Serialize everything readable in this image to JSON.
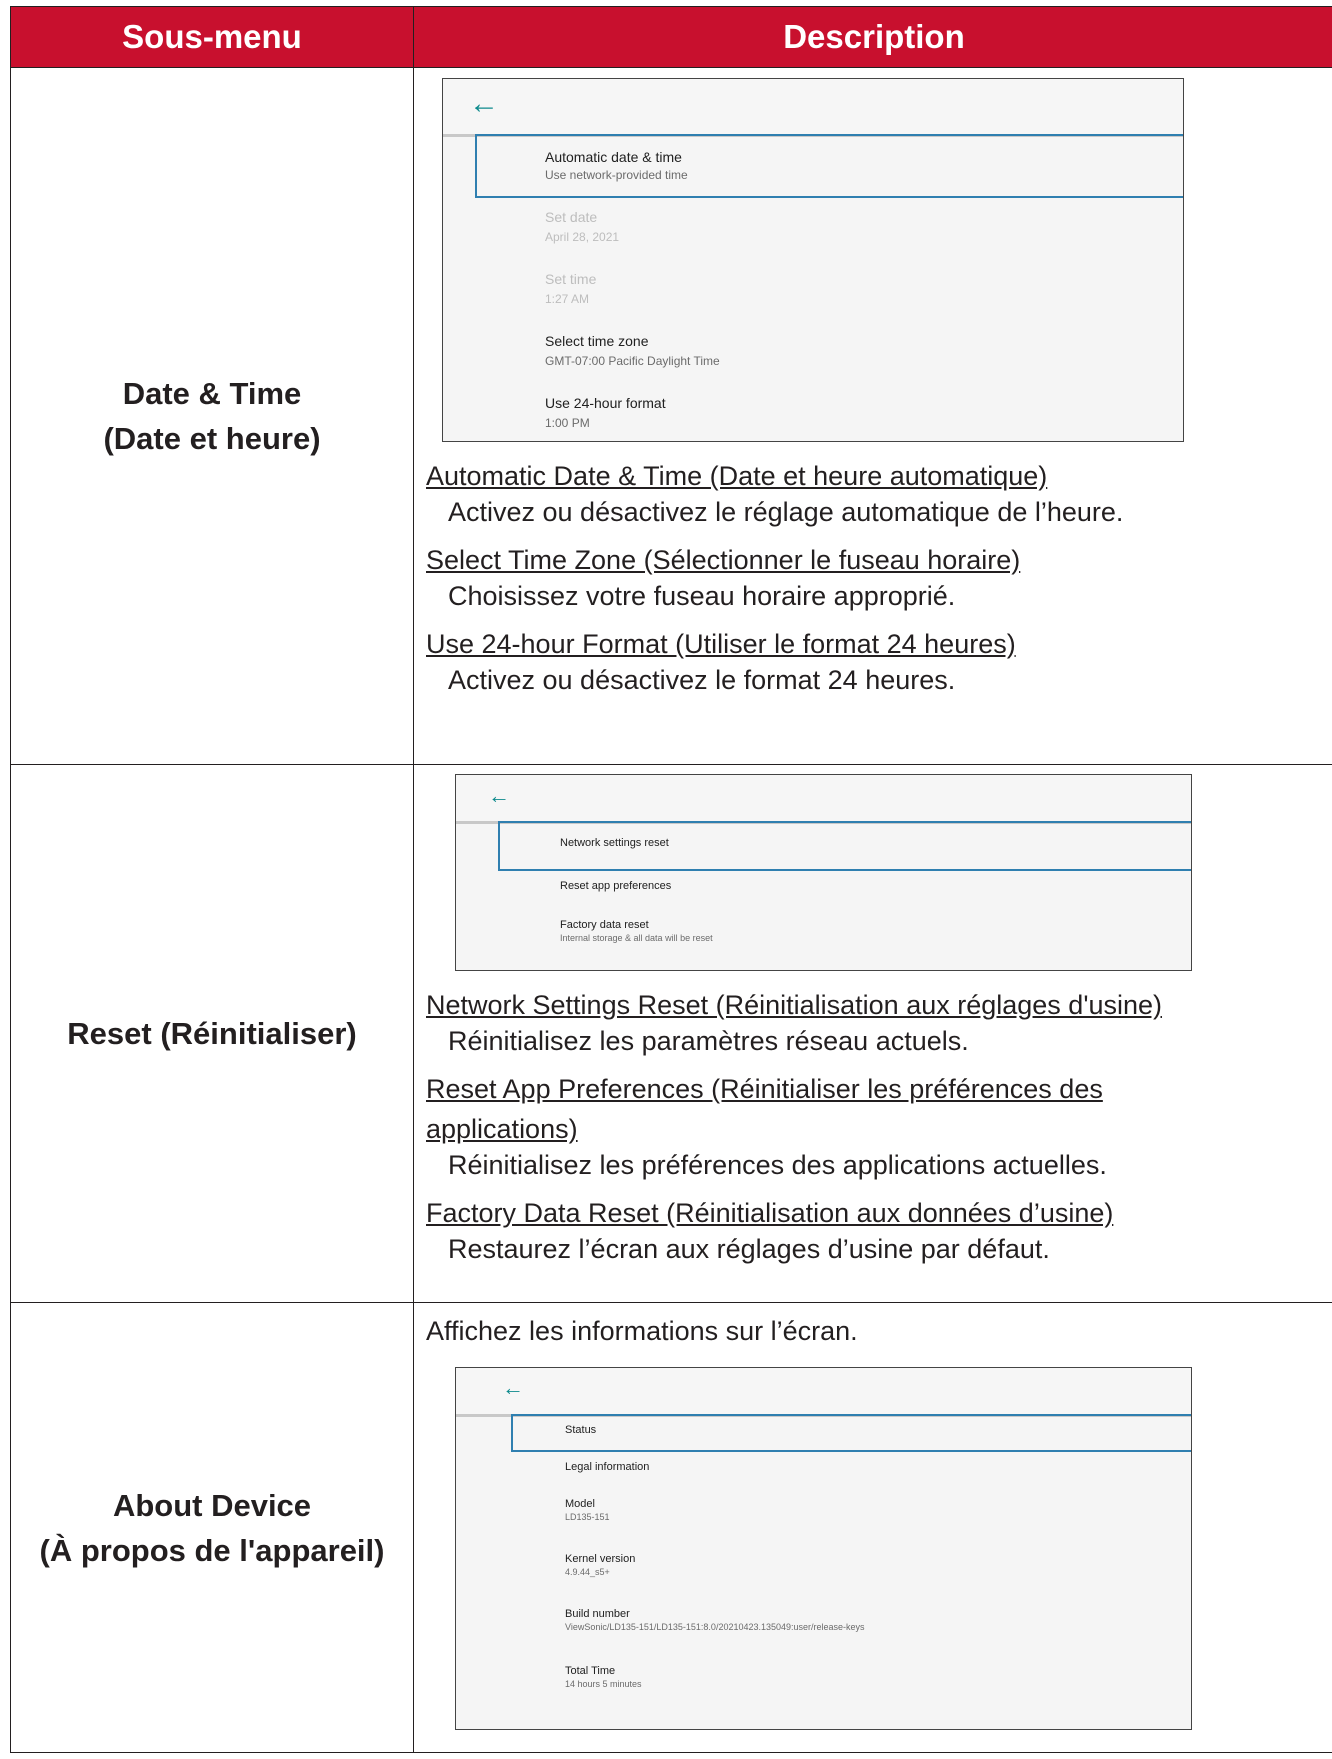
{
  "header": {
    "col1": "Sous-menu",
    "col2": "Description"
  },
  "rows": [
    {
      "label_line1": "Date & Time",
      "label_line2": "(Date et heure)",
      "screen": {
        "items": [
          {
            "title": "Automatic date & time",
            "subtitle": "Use network-provided time"
          },
          {
            "title": "Set date",
            "subtitle": "April 28, 2021"
          },
          {
            "title": "Set time",
            "subtitle": "1:27 AM"
          },
          {
            "title": "Select time zone",
            "subtitle": "GMT-07:00 Pacific Daylight Time"
          },
          {
            "title": "Use 24-hour format",
            "subtitle": "1:00 PM"
          }
        ]
      },
      "entries": [
        {
          "term": "Automatic Date & Time (Date et heure automatique)",
          "desc": "Activez ou désactivez le réglage automatique de l’heure."
        },
        {
          "term": "Select Time Zone (Sélectionner le fuseau horaire)",
          "desc": "Choisissez votre fuseau horaire approprié."
        },
        {
          "term": "Use 24-hour Format (Utiliser le format 24 heures)",
          "desc": "Activez ou désactivez le format 24 heures."
        }
      ]
    },
    {
      "label": "Reset (Réinitialiser)",
      "screen": {
        "items": [
          {
            "title": "Network settings reset"
          },
          {
            "title": "Reset app preferences"
          },
          {
            "title": "Factory data reset",
            "subtitle": "Internal storage & all data will be reset"
          }
        ]
      },
      "entries": [
        {
          "term": "Network Settings Reset (Réinitialisation aux réglages d'usine)",
          "desc": "Réinitialisez les paramètres réseau actuels."
        },
        {
          "term_line1": "Reset App Preferences (Réinitialiser les préférences des ",
          "term_line2": "applications)",
          "desc": "Réinitialisez les préférences des applications actuelles."
        },
        {
          "term": "Factory Data Reset (Réinitialisation aux données d’usine)",
          "desc": "Restaurez l’écran aux réglages d’usine par défaut."
        }
      ]
    },
    {
      "label_line1": "About Device",
      "label_line2": "(À propos de l'appareil)",
      "intro": "Affichez les informations sur l’écran.",
      "screen": {
        "items": [
          {
            "title": "Status"
          },
          {
            "title": "Legal information"
          },
          {
            "title": "Model",
            "subtitle": "LD135-151"
          },
          {
            "title": "Kernel version",
            "subtitle": "4.9.44_s5+"
          },
          {
            "title": "Build number",
            "subtitle": "ViewSonic/LD135-151/LD135-151:8.0/20210423.135049:user/release-keys"
          },
          {
            "title": "Total Time",
            "subtitle": "14 hours 5 minutes"
          }
        ]
      }
    }
  ],
  "icons": {
    "back": "back-arrow-icon"
  },
  "colors": {
    "header_bg": "#c8102e",
    "accent": "#0f8b8d",
    "selection": "#2f7fb0"
  }
}
